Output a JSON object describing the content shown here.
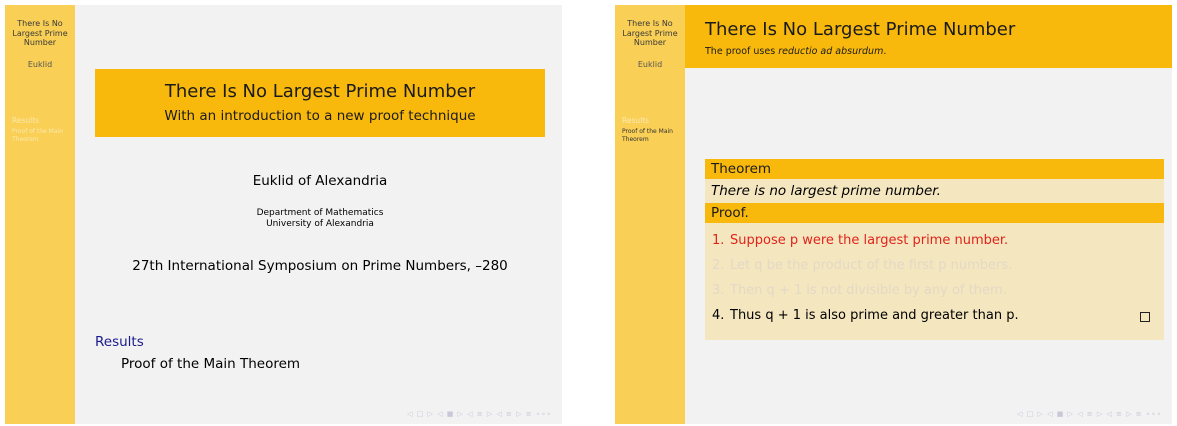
{
  "slides": [
    {
      "sidebar": {
        "title": "There Is No Largest Prime Number",
        "author": "Euklid",
        "section": "Results",
        "subsection": "Proof of the Main Theorem"
      },
      "title": "There Is No Largest Prime Number",
      "subtitle": "With an introduction to a new proof technique",
      "author": "Euklid of Alexandria",
      "institute_line1": "Department of Mathematics",
      "institute_line2": "University of Alexandria",
      "date": "27th International Symposium on Prime Numbers, –280",
      "toc_section": "Results",
      "toc_subsection": "Proof of the Main Theorem",
      "nav_symbols": "◁ □ ▷  ◁ ■ ▷  ◁ ≡ ▷  ◁ ≡ ▷   ≡   ∘∘∘"
    },
    {
      "sidebar": {
        "title": "There Is No Largest Prime Number",
        "author": "Euklid",
        "section": "Results",
        "subsection": "Proof of the Main Theorem"
      },
      "frame_title": "There Is No Largest Prime Number",
      "frame_subtitle_prefix": "The proof uses ",
      "frame_subtitle_em": "reductio ad absurdum",
      "frame_subtitle_suffix": ".",
      "theorem_label": "Theorem",
      "theorem_text": "There is no largest prime number.",
      "proof_label": "Proof.",
      "proof_items": [
        {
          "num": "1.",
          "text": "Suppose p were the largest prime number.",
          "color": "#e0241c"
        },
        {
          "num": "2.",
          "text": "Let q be the product of the first p numbers.",
          "color": "#e3d9c4"
        },
        {
          "num": "3.",
          "text": "Then q + 1 is not divisible by any of them.",
          "color": "#e3d9c4"
        },
        {
          "num": "4.",
          "text": "Thus q + 1 is also prime and greater than p.",
          "color": "#000000"
        }
      ],
      "nav_symbols": "◁ □ ▷  ◁ ■ ▷  ◁ ≡ ▷  ◁ ≡ ▷   ≡   ∘∘∘"
    }
  ]
}
